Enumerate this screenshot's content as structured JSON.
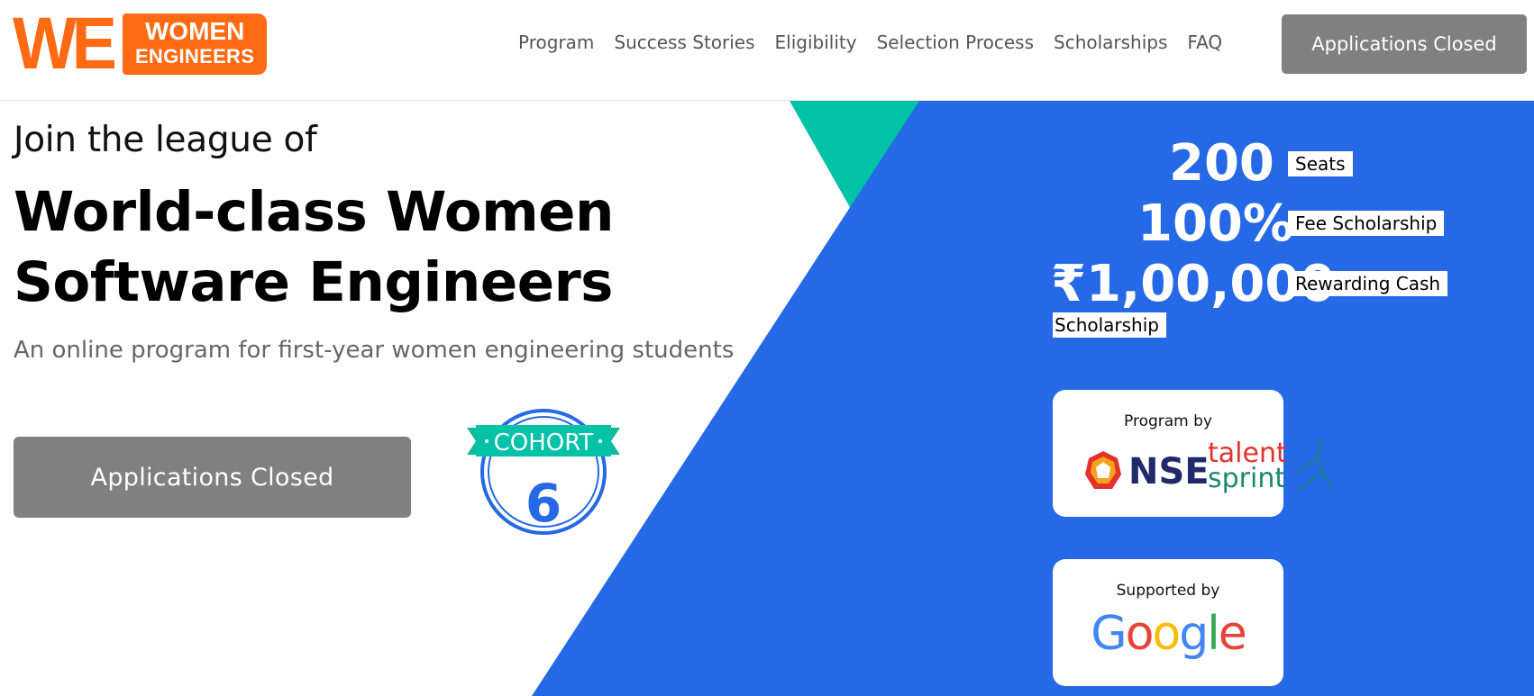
{
  "logo": {
    "we": "WE",
    "line1": "WOMEN",
    "line2": "ENGINEERS"
  },
  "nav": {
    "items": [
      "Program",
      "Success Stories",
      "Eligibility",
      "Selection Process",
      "Scholarships",
      "FAQ"
    ],
    "button_label": "Applications Closed"
  },
  "hero": {
    "pre_title": "Join the league of",
    "title": "World-class Women Software Engineers",
    "subtitle": "An online program for first-year women engineering students",
    "cta_label": "Applications Closed"
  },
  "cohort": {
    "label": "COHORT",
    "number": "6"
  },
  "stats": [
    {
      "value": "200",
      "label": "Seats"
    },
    {
      "value": "100%",
      "label": "Fee Scholarship"
    },
    {
      "value": "₹1,00,000",
      "label": "Rewarding Cash",
      "label_extra": "Scholarship"
    }
  ],
  "program_card": {
    "label": "Program by",
    "nse": "NSE",
    "talent": "talent",
    "sprint": "sprint"
  },
  "support_card": {
    "label": "Supported by",
    "brand": "Google"
  },
  "colors": {
    "brand_orange": "#ff6a13",
    "hero_blue": "#2569e6",
    "teal": "#00c2a6",
    "button_gray": "#808080",
    "nse_red": "#e3312d",
    "nse_navy": "#1f2a6b",
    "sprint_green": "#1a8a6e",
    "google_blue": "#4285F4",
    "google_red": "#EA4335",
    "google_yellow": "#FBBC05",
    "google_green": "#34A853"
  },
  "icons": [
    "cohort-badge-icon",
    "nse-logo-icon",
    "runner-icon"
  ]
}
